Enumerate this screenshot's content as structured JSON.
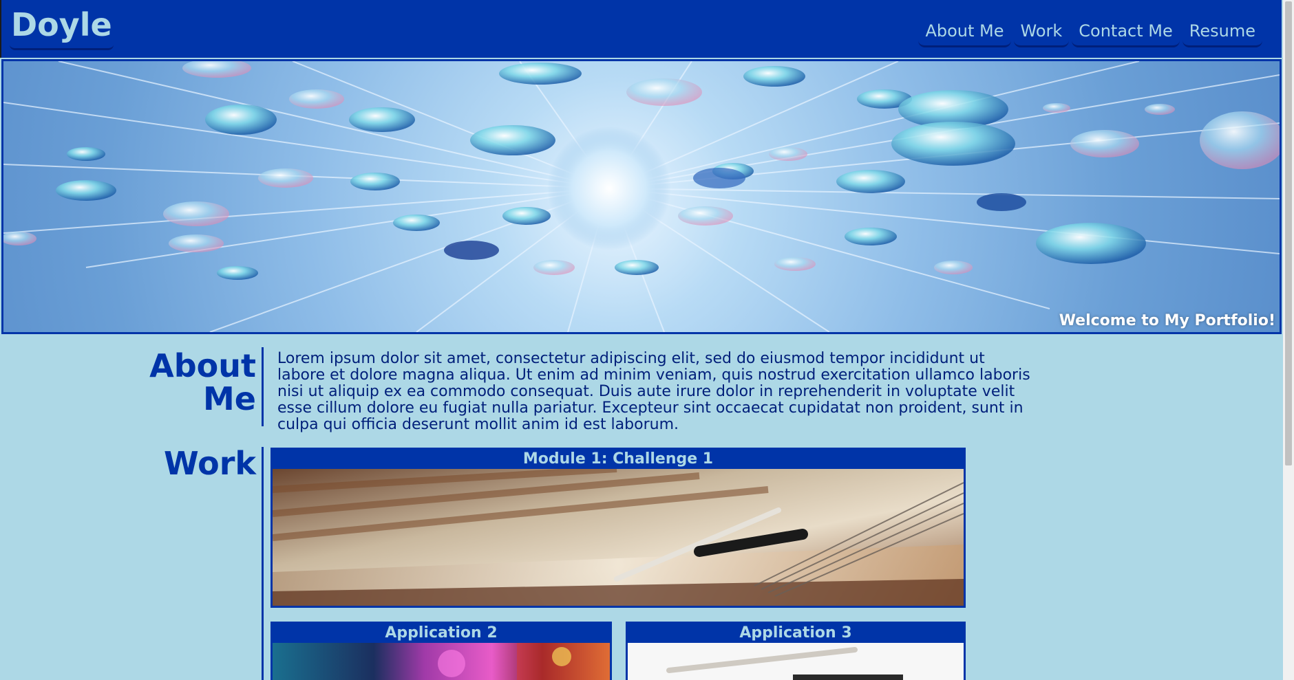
{
  "header": {
    "brand": "Doyle",
    "nav": [
      {
        "label": "About Me"
      },
      {
        "label": "Work"
      },
      {
        "label": "Contact Me"
      },
      {
        "label": "Resume"
      }
    ]
  },
  "hero": {
    "caption": "Welcome to My Portfolio!"
  },
  "about": {
    "title_line1": "About",
    "title_line2": "Me",
    "text": "Lorem ipsum dolor sit amet, consectetur adipiscing elit, sed do eiusmod tempor incididunt ut labore et dolore magna aliqua. Ut enim ad minim veniam, quis nostrud exercitation ullamco laboris nisi ut aliquip ex ea commodo consequat. Duis aute irure dolor in reprehenderit in voluptate velit esse cillum dolore eu fugiat nulla pariatur. Excepteur sint occaecat cupidatat non proident, sunt in culpa qui officia deserunt mollit anim id est laborum."
  },
  "work": {
    "title": "Work",
    "projects": [
      {
        "title": "Module 1: Challenge 1"
      },
      {
        "title": "Application 2"
      },
      {
        "title": "Application 3"
      }
    ]
  },
  "colors": {
    "primary": "#0034a8",
    "background": "#add8e6",
    "text_dark": "#001f7a"
  }
}
